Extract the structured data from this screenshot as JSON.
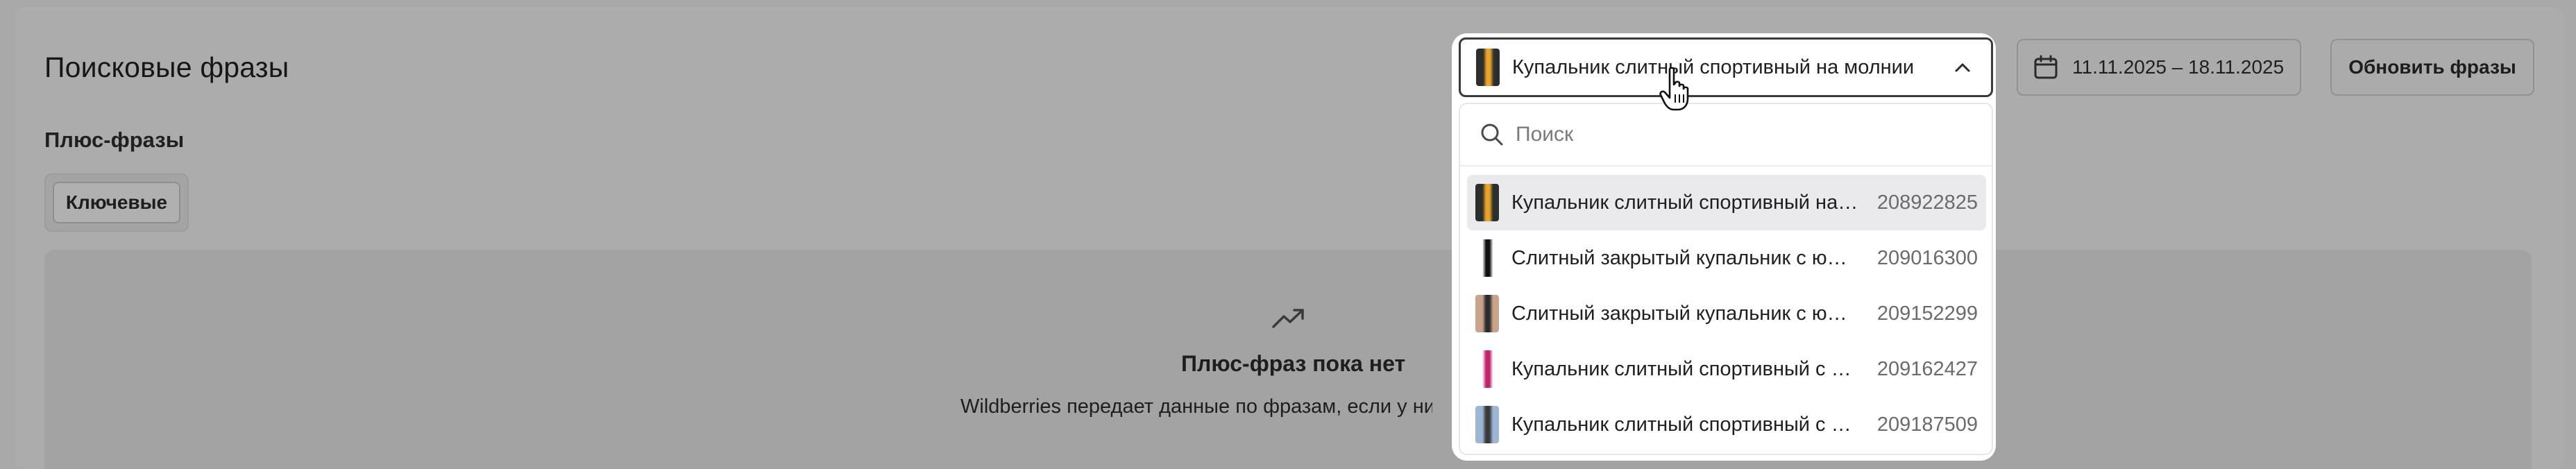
{
  "page": {
    "title": "Поисковые фразы",
    "section_title": "Плюс-фразы",
    "tab_key": "Ключевые",
    "empty_title": "Плюс-фраз пока нет",
    "empty_desc": "Wildberries передает данные по фразам, если у них бол"
  },
  "toolbar": {
    "date_range": "11.11.2025 – 18.11.2025",
    "refresh_label": "Обновить фразы"
  },
  "selector": {
    "selected_label": "Купальник слитный спортивный на молнии",
    "search_placeholder": "Поиск",
    "options": [
      {
        "name": "Купальник слитный спортивный на молнии",
        "id": "208922825",
        "thumb": "#2a2f2b",
        "accent": "#e9a22a",
        "active": true
      },
      {
        "name": "Слитный закрытый купальник с юбкой",
        "id": "209016300",
        "thumb": "#ffffff",
        "accent": "#111111",
        "active": false
      },
      {
        "name": "Слитный закрытый купальник с юбкой",
        "id": "209152299",
        "thumb": "#c7a48a",
        "accent": "#2c2c2c",
        "active": false
      },
      {
        "name": "Купальник слитный спортивный с шортами",
        "id": "209162427",
        "thumb": "#ffffff",
        "accent": "#c2236b",
        "active": false
      },
      {
        "name": "Купальник слитный спортивный с шортами",
        "id": "209187509",
        "thumb": "#9bb7d4",
        "accent": "#3a3a3a",
        "active": false
      }
    ]
  },
  "colors": {
    "overlay": "#a9a9a9",
    "active_option_bg": "#e9e9ee",
    "id_text": "#6b6b6b"
  }
}
